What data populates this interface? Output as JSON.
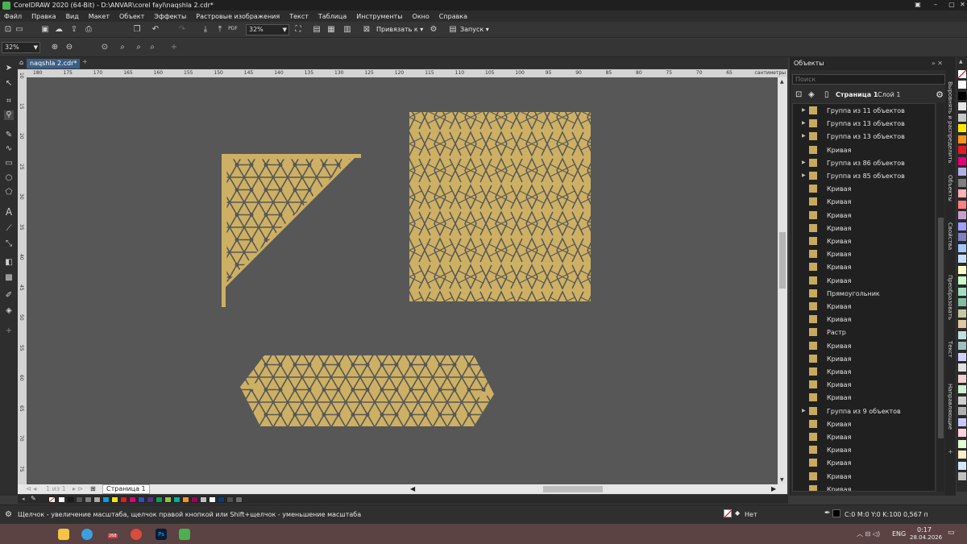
{
  "titlebar": {
    "title": "CorelDRAW 2020 (64-Bit) - D:\\ANVAR\\corel fayl\\naqshla 2.cdr*"
  },
  "menu": [
    "Файл",
    "Правка",
    "Вид",
    "Макет",
    "Объект",
    "Эффекты",
    "Растровые изображения",
    "Текст",
    "Таблица",
    "Инструменты",
    "Окно",
    "Справка"
  ],
  "toolbar1": {
    "zoom": "32%",
    "snap_label": "Привязать к",
    "launch_label": "Запуск",
    "pdf_label": "PDF"
  },
  "toolbar2": {
    "zoom": "32%"
  },
  "document": {
    "tab": "naqshla 2.cdr*"
  },
  "ruler": {
    "units": "сантиметры",
    "h_ticks": [
      "180",
      "175",
      "170",
      "165",
      "160",
      "155",
      "150",
      "145",
      "140",
      "135",
      "130",
      "125",
      "120",
      "115",
      "110",
      "105",
      "100",
      "95",
      "90",
      "85",
      "80",
      "75",
      "70",
      "65"
    ],
    "v_ticks": [
      "10",
      "15",
      "20",
      "25",
      "30",
      "35",
      "40",
      "45",
      "50",
      "55",
      "60",
      "65",
      "70",
      "75"
    ]
  },
  "pagebar": {
    "page_counter": "1 из 1",
    "page_tab": "Страница 1"
  },
  "status": {
    "hint": "Щелчок - увеличение масштаба, щелчок правой кнопкой или Shift+щелчок - уменьшение масштаба",
    "fill_label": "Нет",
    "color_info": "C:0 M:0 Y:0 K:100  0,567 п"
  },
  "panel": {
    "title": "Объекты",
    "search_placeholder": "Поиск",
    "page_label": "Страница 1",
    "layer_label": "Слой 1",
    "items": [
      {
        "label": "Группа из 11 объектов",
        "expandable": true
      },
      {
        "label": "Группа из 13 объектов",
        "expandable": true
      },
      {
        "label": "Группа из 13 объектов",
        "expandable": true
      },
      {
        "label": "Кривая",
        "expandable": false
      },
      {
        "label": "Группа из 86 объектов",
        "expandable": true
      },
      {
        "label": "Группа из 85 объектов",
        "expandable": true
      },
      {
        "label": "Кривая",
        "expandable": false
      },
      {
        "label": "Кривая",
        "expandable": false
      },
      {
        "label": "Кривая",
        "expandable": false
      },
      {
        "label": "Кривая",
        "expandable": false
      },
      {
        "label": "Кривая",
        "expandable": false
      },
      {
        "label": "Кривая",
        "expandable": false
      },
      {
        "label": "Кривая",
        "expandable": false
      },
      {
        "label": "Кривая",
        "expandable": false
      },
      {
        "label": "Прямоугольник",
        "expandable": false
      },
      {
        "label": "Кривая",
        "expandable": false
      },
      {
        "label": "Кривая",
        "expandable": false
      },
      {
        "label": "Растр",
        "expandable": false
      },
      {
        "label": "Кривая",
        "expandable": false
      },
      {
        "label": "Кривая",
        "expandable": false
      },
      {
        "label": "Кривая",
        "expandable": false
      },
      {
        "label": "Кривая",
        "expandable": false
      },
      {
        "label": "Кривая",
        "expandable": false
      },
      {
        "label": "Группа из 9 объектов",
        "expandable": true
      },
      {
        "label": "Кривая",
        "expandable": false
      },
      {
        "label": "Кривая",
        "expandable": false
      },
      {
        "label": "Кривая",
        "expandable": false
      },
      {
        "label": "Кривая",
        "expandable": false
      },
      {
        "label": "Кривая",
        "expandable": false
      },
      {
        "label": "Кривая",
        "expandable": false
      }
    ]
  },
  "dock_tabs": [
    "Выровнять и распределить",
    "Объекты",
    "Свойства",
    "Преобразовать",
    "Текст",
    "Направляющие"
  ],
  "taskbar": {
    "language": "ENG",
    "time": "0:17",
    "date": "28.04.2026",
    "badge": "268",
    "ps_label": "Ps"
  },
  "colors": {
    "ornament": "#cdb063",
    "canvas": "#575757",
    "accent": "#3b5f86"
  },
  "palette_bottom": [
    "#ffffff",
    "#1a1a1a",
    "#555555",
    "#7f7f7f",
    "#aaaaaa",
    "#00a0e0",
    "#ffe600",
    "#e01b24",
    "#e2007a",
    "#3050c0",
    "#5a2d91",
    "#00a651",
    "#8dc63f",
    "#00b0a0",
    "#f7941d",
    "#9e005d",
    "#c0c0c0",
    "#ffffff",
    "#003f7f",
    "#505050",
    "#6d6d6d"
  ],
  "palette_right": [
    "#ffffff",
    "#000000",
    "#e6e6e6",
    "#c8c8c8",
    "#ffe600",
    "#f7941d",
    "#e01b24",
    "#e2007a",
    "#b0b0e8",
    "#7f7f7f",
    "#ffb0b0",
    "#ff8080",
    "#c8a0d0",
    "#a0a0ff",
    "#8080c0",
    "#a0c8ff",
    "#c8e0ff",
    "#ffffc8",
    "#c8ffc8",
    "#a0e0c0",
    "#80c0a0",
    "#c8c8a0",
    "#e0c8a0",
    "#c0e0e0",
    "#a0c0c0",
    "#d0d0ff",
    "#e0e0e0",
    "#f0d0d0",
    "#d0f0d0",
    "#d0d0d0",
    "#b0b0b0",
    "#c8c8ff",
    "#ffd0e0",
    "#e0ffd0",
    "#fff0c8",
    "#d0e8ff",
    "#c0c0c0"
  ]
}
